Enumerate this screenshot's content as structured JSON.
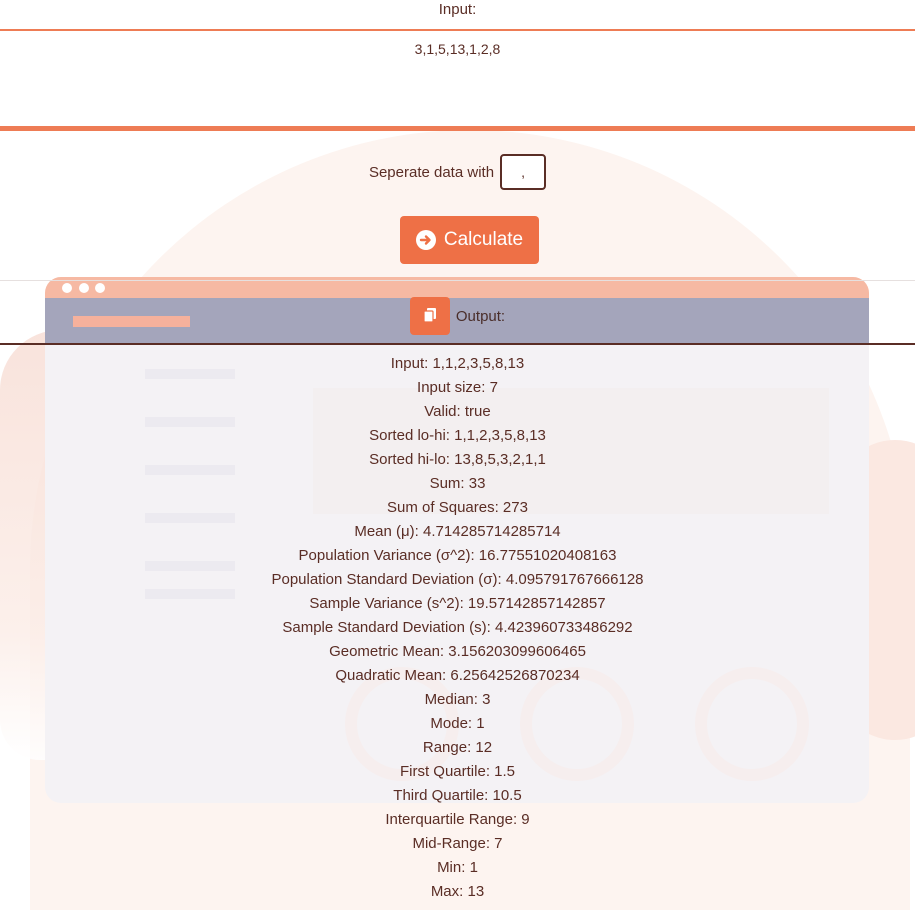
{
  "input": {
    "label": "Input:",
    "value": "3,1,5,13,1,2,8"
  },
  "separator": {
    "label": "Seperate data with",
    "value": ","
  },
  "calculate": {
    "label": "Calculate",
    "icon": "arrow-right-circle-icon"
  },
  "output": {
    "label": "Output:",
    "copy_icon": "copy-icon",
    "results": [
      "Input: 1,1,2,3,5,8,13",
      "Input size: 7",
      "Valid: true",
      "Sorted lo-hi: 1,1,2,3,5,8,13",
      "Sorted hi-lo: 13,8,5,3,2,1,1",
      "Sum: 33",
      "Sum of Squares: 273",
      "Mean (μ): 4.714285714285714",
      "Population Variance (σ^2): 16.77551020408163",
      "Population Standard Deviation (σ): 4.095791767666128",
      "Sample Variance (s^2): 19.57142857142857",
      "Sample Standard Deviation (s): 4.423960733486292",
      "Geometric Mean: 3.156203099606465",
      "Quadratic Mean: 6.25642526870234",
      "Median: 3",
      "Mode: 1",
      "Range: 12",
      "First Quartile: 1.5",
      "Third Quartile: 10.5",
      "Interquartile Range: 9",
      "Mid-Range: 7",
      "Min: 1",
      "Max: 13"
    ]
  },
  "colors": {
    "accent": "#ee7046",
    "text": "#5a2d25",
    "rule_accent": "#ee7c55",
    "rule_dark": "#5a2d25"
  }
}
